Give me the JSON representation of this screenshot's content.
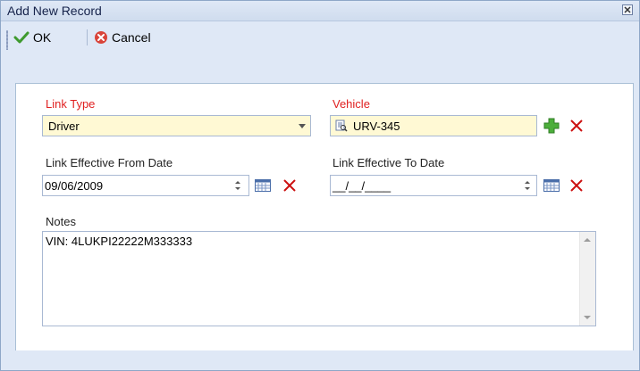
{
  "window": {
    "title": "Add New Record"
  },
  "toolbar": {
    "ok_label": "OK",
    "cancel_label": "Cancel"
  },
  "form": {
    "link_type": {
      "label": "Link Type",
      "value": "Driver"
    },
    "vehicle": {
      "label": "Vehicle",
      "value": "URV-345"
    },
    "from_date": {
      "label": "Link Effective From Date",
      "value": "09/06/2009"
    },
    "to_date": {
      "label": "Link Effective To Date",
      "value": "__/__/____"
    },
    "notes": {
      "label": "Notes",
      "value": "VIN: 4LUKPI22222M333333"
    }
  },
  "colors": {
    "required_label": "#e02020",
    "highlight_field": "#fff9d4",
    "accent": "#8ea7c7",
    "delete_icon": "#cc1111",
    "add_icon": "#3aa23a"
  },
  "icons": [
    "check-icon",
    "cancel-icon",
    "close-icon",
    "dropdown-arrow-icon",
    "lookup-icon",
    "add-icon",
    "delete-icon",
    "calendar-icon"
  ]
}
